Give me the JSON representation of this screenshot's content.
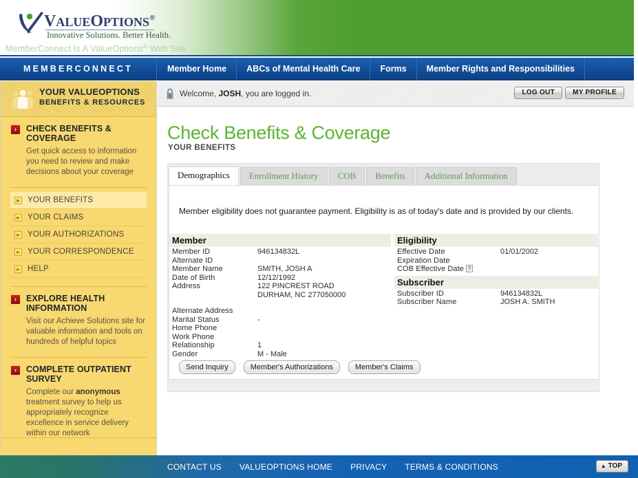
{
  "header": {
    "logo_main": "VALUEOPTIONS",
    "logo_v": "V",
    "logo_alue": "ALUE",
    "logo_o": "O",
    "logo_ptions": "PTIONS",
    "logo_reg": "®",
    "logo_tagline": "Innovative Solutions. Better Health.",
    "site_tagline_pre": "MemberConnect Is A ValueOptions",
    "site_tagline_reg": "®",
    "site_tagline_post": " Web Site",
    "brand": "MEMBERCONNECT",
    "nav_items": [
      {
        "label": "Member Home"
      },
      {
        "label": "ABCs of Mental Health Care"
      },
      {
        "label": "Forms"
      },
      {
        "label": "Member Rights and Responsibilities"
      }
    ]
  },
  "welcome": {
    "lock_icon": "lock-icon",
    "text_pre": "Welcome, ",
    "user": "JOSH",
    "text_post": ", you are logged in.",
    "logout_label": "LOG OUT",
    "profile_label": "MY PROFILE"
  },
  "sidebar": {
    "header_title": "YOUR VALUEOPTIONS",
    "header_subtitle": "BENEFITS & RESOURCES",
    "header_icon": "people-group-icon",
    "sections": [
      {
        "title": "CHECK BENEFITS & COVERAGE",
        "desc": "Get quick access to information you need to review and make decisions about your coverage"
      },
      {
        "title": "EXPLORE HEALTH INFORMATION",
        "desc": "Visit our Achieve Solutions site for valuable information and tools on hundreds of helpful topics"
      },
      {
        "title": "COMPLETE OUTPATIENT SURVEY",
        "desc_pre": "Complete our ",
        "desc_bold": "anonymous",
        "desc_post": " treatment survey to help us appropriately recognize excellence in service delivery within our network"
      }
    ],
    "items": [
      {
        "label": "YOUR BENEFITS",
        "active": true
      },
      {
        "label": "YOUR CLAIMS",
        "active": false
      },
      {
        "label": "YOUR AUTHORIZATIONS",
        "active": false
      },
      {
        "label": "YOUR CORRESPONDENCE",
        "active": false
      },
      {
        "label": "HELP",
        "active": false
      }
    ]
  },
  "page": {
    "title": "Check Benefits & Coverage",
    "subtitle": "YOUR BENEFITS"
  },
  "tabs": [
    {
      "label": "Demographics",
      "active": true
    },
    {
      "label": "Enrollment History",
      "active": false
    },
    {
      "label": "COB",
      "active": false
    },
    {
      "label": "Benefits",
      "active": false
    },
    {
      "label": "Additional Information",
      "active": false
    }
  ],
  "content": {
    "disclaimer": "Member eligibility does not guarantee payment. Eligibility is as of today's date and is provided by our clients.",
    "member": {
      "heading": "Member",
      "rows": [
        {
          "label": "Member ID",
          "value": "946134832L"
        },
        {
          "label": "Alternate ID",
          "value": ""
        },
        {
          "label": "Member Name",
          "value": "SMITH, JOSH A"
        },
        {
          "label": "Date of Birth",
          "value": "12/12/1992"
        },
        {
          "label": "Address",
          "value": "122 PINCREST ROAD"
        },
        {
          "label": "",
          "value": "DURHAM, NC 277050000"
        },
        {
          "label": "Alternate Address",
          "value": ""
        },
        {
          "label": "Marital Status",
          "value": "-"
        },
        {
          "label": "Home Phone",
          "value": ""
        },
        {
          "label": "Work Phone",
          "value": ""
        },
        {
          "label": "Relationship",
          "value": "1"
        },
        {
          "label": "Gender",
          "value": "M - Male"
        }
      ]
    },
    "eligibility": {
      "heading": "Eligibility",
      "rows": [
        {
          "label": "Effective Date",
          "value": "01/01/2002"
        },
        {
          "label": "Expiration Date",
          "value": ""
        },
        {
          "label": "COB Effective Date",
          "value": "",
          "help": "?"
        }
      ]
    },
    "subscriber": {
      "heading": "Subscriber",
      "rows": [
        {
          "label": "Subscriber ID",
          "value": "946134832L"
        },
        {
          "label": "Subscriber Name",
          "value": "JOSH A. SMITH"
        }
      ]
    },
    "actions": [
      {
        "label": "Send Inquiry"
      },
      {
        "label": "Member's Authorizations"
      },
      {
        "label": "Member's Claims"
      }
    ]
  },
  "footer": {
    "links": [
      {
        "label": "CONTACT US"
      },
      {
        "label": "VALUEOPTIONS HOME"
      },
      {
        "label": "PRIVACY"
      },
      {
        "label": "TERMS & CONDITIONS"
      }
    ],
    "top_label": "TOP",
    "top_icon": "triangle-up-icon"
  },
  "colors": {
    "brand_green": "#4f9e32",
    "title_green": "#5bb431",
    "nav_blue": "#14539f",
    "sidebar_yellow": "#f8d870",
    "accent_red": "#b31a1a"
  }
}
